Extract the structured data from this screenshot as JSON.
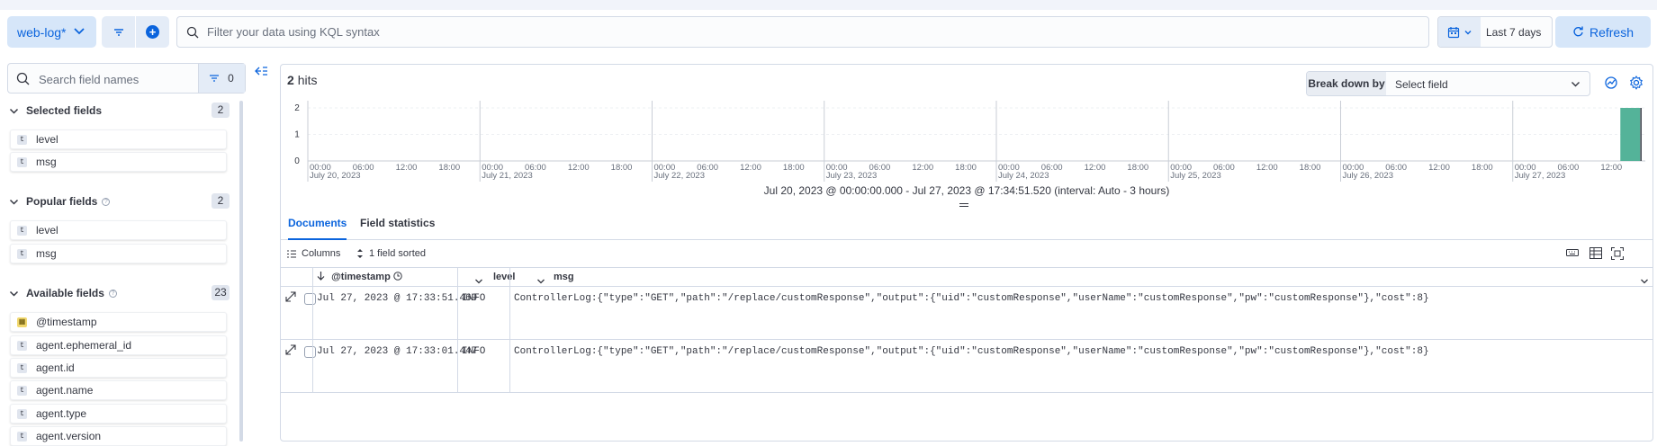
{
  "topbar": {
    "data_view": "web-log*",
    "search_placeholder": "Filter your data using KQL syntax",
    "time_range": "Last 7 days",
    "refresh_label": "Refresh"
  },
  "sidebar": {
    "search_placeholder": "Search field names",
    "filter_count": "0",
    "selected": {
      "title": "Selected fields",
      "count": "2",
      "fields": [
        "level",
        "msg"
      ]
    },
    "popular": {
      "title": "Popular fields",
      "count": "2",
      "fields": [
        "level",
        "msg"
      ]
    },
    "available": {
      "title": "Available fields",
      "count": "23",
      "fields": [
        "@timestamp",
        "agent.ephemeral_id",
        "agent.id",
        "agent.name",
        "agent.type",
        "agent.version"
      ]
    }
  },
  "main": {
    "hits_count": "2",
    "hits_label": "hits",
    "breakdown_label": "Break down by",
    "breakdown_value": "Select field",
    "interval_text": "Jul 20, 2023 @ 00:00:00.000 - Jul 27, 2023 @ 17:34:51.520 (interval: Auto - 3 hours)",
    "tabs": [
      "Documents",
      "Field statistics"
    ],
    "columns_label": "Columns",
    "sorted_label": "1 field sorted",
    "headers": [
      "@timestamp",
      "level",
      "msg"
    ],
    "rows": [
      {
        "timestamp": "Jul 27, 2023 @ 17:33:51.469",
        "level": "INFO",
        "msg": "ControllerLog:{\"type\":\"GET\",\"path\":\"/replace/customResponse\",\"output\":{\"uid\":\"customResponse\",\"userName\":\"customResponse\",\"pw\":\"customResponse\"},\"cost\":8}"
      },
      {
        "timestamp": "Jul 27, 2023 @ 17:33:01.447",
        "level": "INFO",
        "msg": "ControllerLog:{\"type\":\"GET\",\"path\":\"/replace/customResponse\",\"output\":{\"uid\":\"customResponse\",\"userName\":\"customResponse\",\"pw\":\"customResponse\"},\"cost\":8}"
      }
    ]
  },
  "chart_data": {
    "type": "bar",
    "y_ticks": [
      "2",
      "1",
      "0"
    ],
    "ylim": [
      0,
      2
    ],
    "hour_ticks": [
      "00:00",
      "06:00",
      "12:00",
      "18:00"
    ],
    "day_labels": [
      "July 20, 2023",
      "July 21, 2023",
      "July 22, 2023",
      "July 23, 2023",
      "July 24, 2023",
      "July 25, 2023",
      "July 26, 2023",
      "July 27, 2023"
    ],
    "last_day_ticks": [
      "00:00",
      "06:00",
      "12:00"
    ],
    "bar_color": "#54b399",
    "series": [
      {
        "x_range": [
          "Jul 27, 2023 @ 15:00",
          "Jul 27, 2023 @ 18:00"
        ],
        "value": 2
      }
    ]
  },
  "colors": {
    "accent": "#0b64dd",
    "bar": "#54b399"
  }
}
